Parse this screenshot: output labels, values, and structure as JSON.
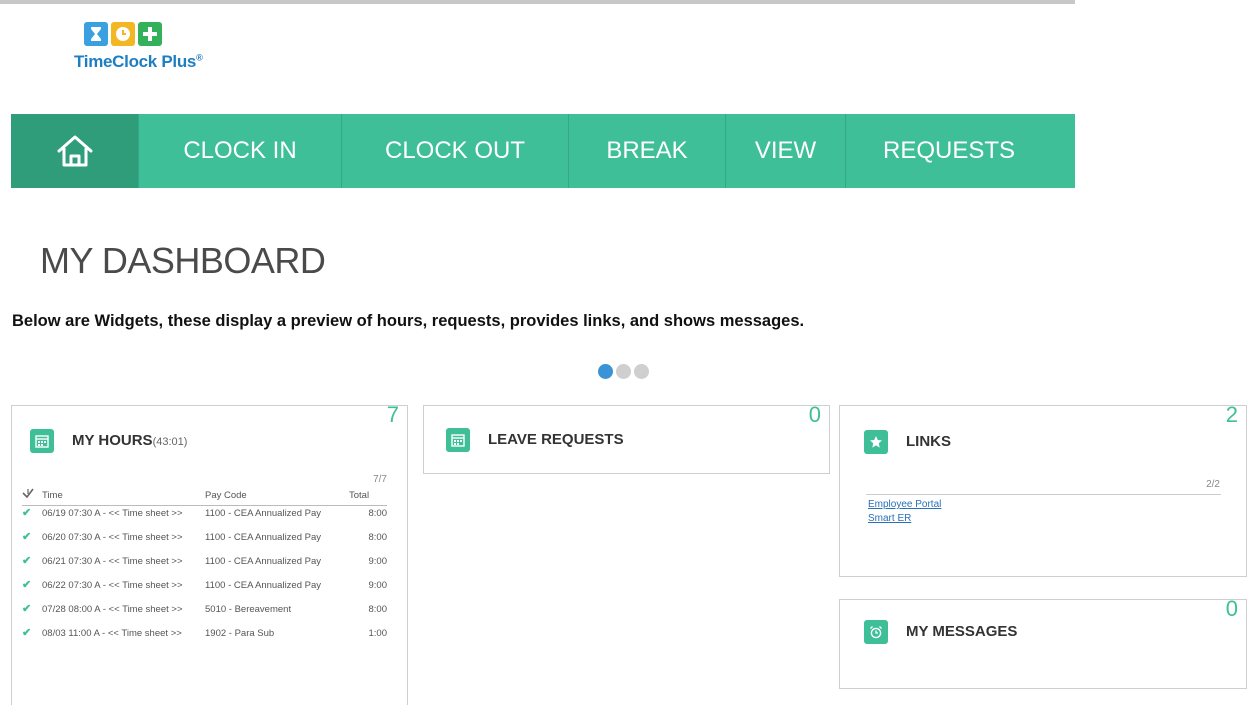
{
  "app": {
    "logo_text": "TimeClock Plus",
    "logo_mark": "®"
  },
  "nav": {
    "home_icon": "home-icon",
    "items": [
      {
        "label": "CLOCK IN"
      },
      {
        "label": "CLOCK OUT"
      },
      {
        "label": "BREAK"
      },
      {
        "label": "VIEW"
      },
      {
        "label": "REQUESTS"
      }
    ]
  },
  "page": {
    "title": "MY DASHBOARD",
    "subtitle": "Below are Widgets, these display a preview of hours, requests, provides links, and shows messages."
  },
  "carousel": {
    "pages": 3,
    "active": 1
  },
  "colors": {
    "accent": "#3ebf98",
    "accent_dark": "#2f9d7a",
    "link": "#2a6fb8",
    "active_dot": "#3a93d6"
  },
  "widgets": {
    "hours": {
      "title": "MY HOURS",
      "total": "(43:01)",
      "count": "7",
      "pager": "7/7",
      "columns": {
        "time": "Time",
        "pay_code": "Pay Code",
        "total": "Total"
      },
      "rows": [
        {
          "time": "06/19 07:30 A - << Time sheet >>",
          "pay_code": "1100 - CEA Annualized Pay",
          "total": "8:00"
        },
        {
          "time": "06/20 07:30 A - << Time sheet >>",
          "pay_code": "1100 - CEA Annualized Pay",
          "total": "8:00"
        },
        {
          "time": "06/21 07:30 A - << Time sheet >>",
          "pay_code": "1100 - CEA Annualized Pay",
          "total": "9:00"
        },
        {
          "time": "06/22 07:30 A - << Time sheet >>",
          "pay_code": "1100 - CEA Annualized Pay",
          "total": "9:00"
        },
        {
          "time": "07/28 08:00 A - << Time sheet >>",
          "pay_code": "5010 - Bereavement",
          "total": "8:00"
        },
        {
          "time": "08/03 11:00 A - << Time sheet >>",
          "pay_code": "1902 - Para Sub",
          "total": "1:00"
        }
      ]
    },
    "leave": {
      "title": "LEAVE REQUESTS",
      "count": "0"
    },
    "links": {
      "title": "LINKS",
      "count": "2",
      "pager": "2/2",
      "items": [
        {
          "label": "Employee Portal"
        },
        {
          "label": "Smart ER"
        }
      ]
    },
    "messages": {
      "title": "MY MESSAGES",
      "count": "0"
    }
  }
}
